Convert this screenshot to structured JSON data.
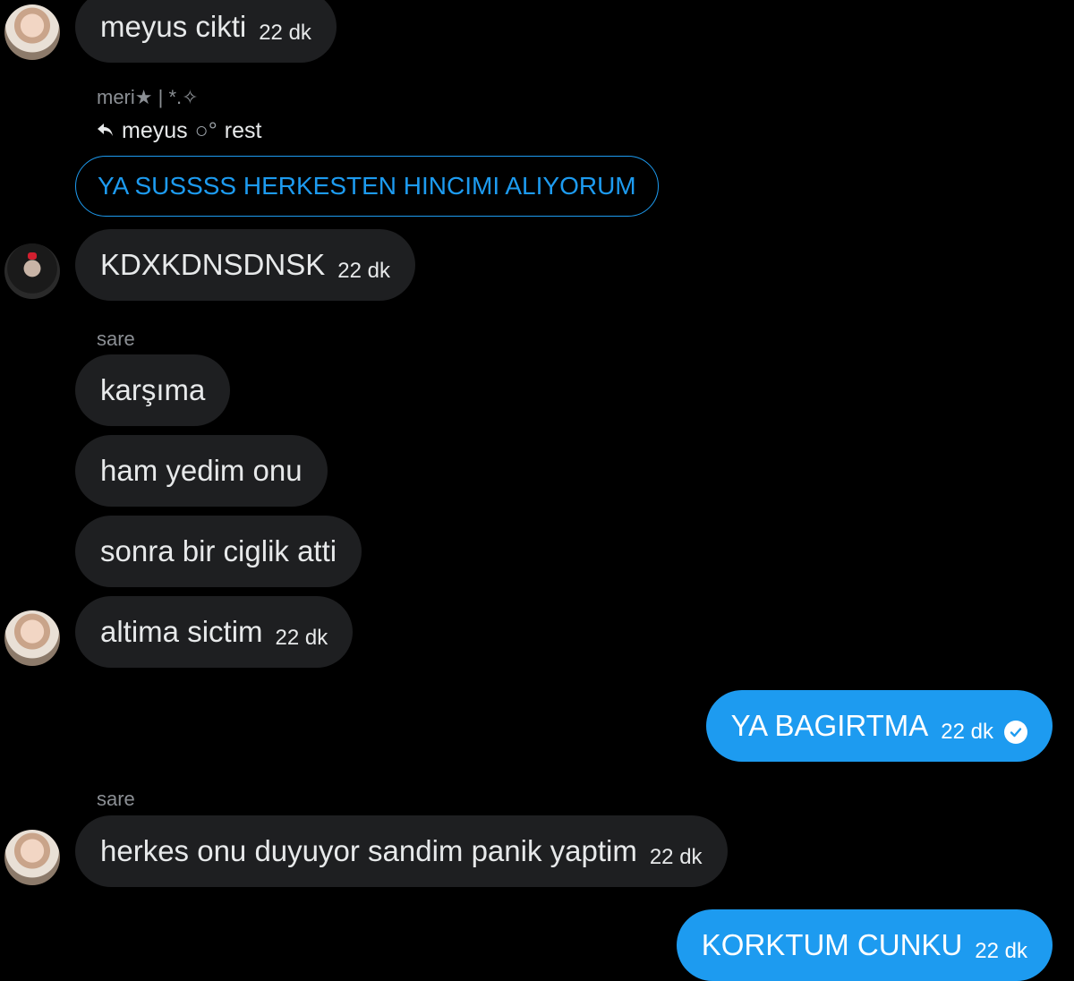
{
  "messages": [
    {
      "text": "meyus cikti",
      "time": "22 dk"
    },
    {
      "sender": "meri★ | *.✧",
      "reply_to": "meyus",
      "reply_emoji": "○°",
      "reply_text": "rest",
      "quoted": "YA SUSSSS HERKESTEN HINCIMI ALIYORUM"
    },
    {
      "text": "KDXKDNSDNSK",
      "time": "22 dk"
    },
    {
      "sender": "sare"
    },
    {
      "text": "karşıma"
    },
    {
      "text": "ham yedim onu"
    },
    {
      "text": "sonra bir ciglik atti"
    },
    {
      "text": "altima sictim",
      "time": "22 dk"
    },
    {
      "text": "YA BAGIRTMA",
      "time": "22 dk",
      "outgoing": true
    },
    {
      "sender": "sare"
    },
    {
      "text": "herkes onu duyuyor sandim panik yaptim",
      "time": "22 dk"
    },
    {
      "text": "KORKTUM CUNKU",
      "time": "22 dk",
      "outgoing": true
    }
  ],
  "colors": {
    "background": "#000000",
    "incoming": "#1e1f21",
    "outgoing": "#1d9bf0"
  },
  "icons": [
    "reply-arrow-icon",
    "read-check-icon"
  ]
}
